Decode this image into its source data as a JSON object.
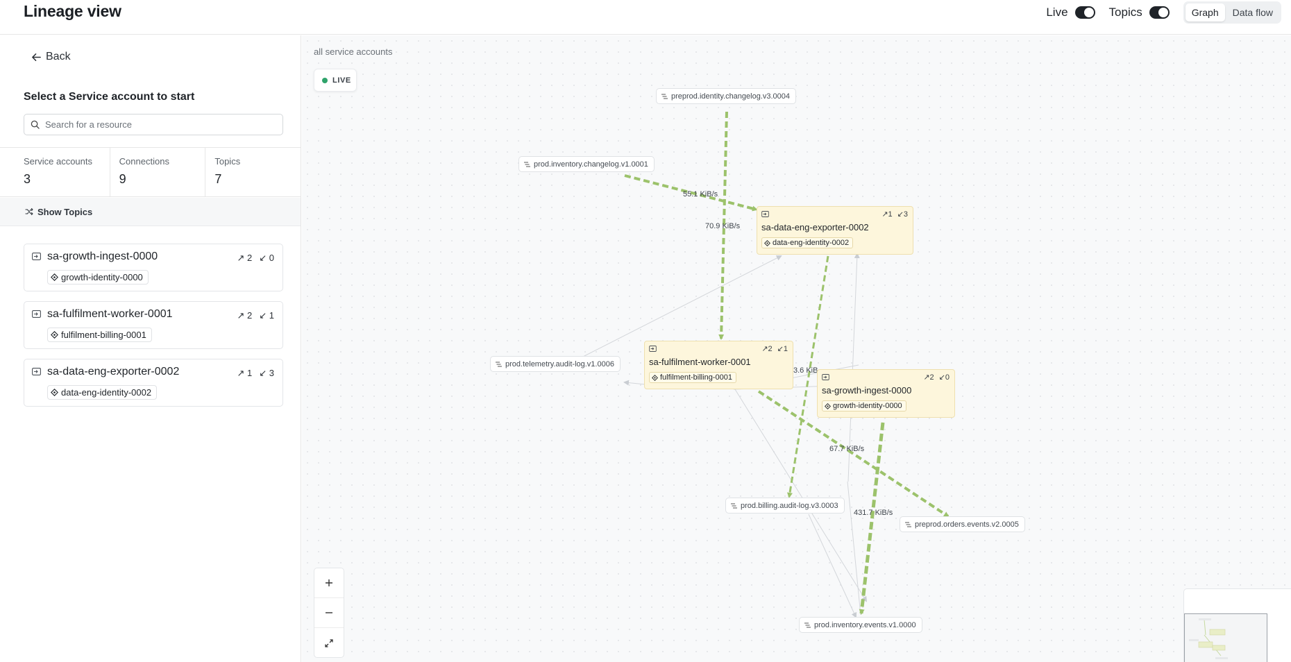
{
  "header": {
    "title": "Lineage view",
    "live_label": "Live",
    "topics_label": "Topics",
    "view_tabs": [
      "Graph",
      "Data flow"
    ],
    "active_tab": "Graph"
  },
  "sidebar": {
    "back_label": "Back",
    "select_title": "Select a Service account to start",
    "search_placeholder": "Search for a resource",
    "stats": [
      {
        "label": "Service accounts",
        "value": "3"
      },
      {
        "label": "Connections",
        "value": "9"
      },
      {
        "label": "Topics",
        "value": "7"
      }
    ],
    "show_topics_label": "Show Topics",
    "accounts": [
      {
        "name": "sa-growth-ingest-0000",
        "identity": "growth-identity-0000",
        "out": "2",
        "in": "0"
      },
      {
        "name": "sa-fulfilment-worker-0001",
        "identity": "fulfilment-billing-0001",
        "out": "2",
        "in": "1"
      },
      {
        "name": "sa-data-eng-exporter-0002",
        "identity": "data-eng-identity-0002",
        "out": "1",
        "in": "3"
      }
    ]
  },
  "canvas": {
    "breadcrumb": "all service accounts",
    "live_badge": "LIVE",
    "topics": [
      "preprod.identity.changelog.v3.0004",
      "prod.inventory.changelog.v1.0001",
      "prod.telemetry.audit-log.v1.0006",
      "prod.billing.audit-log.v3.0003",
      "preprod.orders.events.v2.0005",
      "prod.inventory.events.v1.0000"
    ],
    "service_nodes": [
      {
        "name": "sa-data-eng-exporter-0002",
        "identity": "data-eng-identity-0002",
        "out": "1",
        "in": "3"
      },
      {
        "name": "sa-fulfilment-worker-0001",
        "identity": "fulfilment-billing-0001",
        "out": "2",
        "in": "1"
      },
      {
        "name": "sa-growth-ingest-0000",
        "identity": "growth-identity-0000",
        "out": "2",
        "in": "0"
      }
    ],
    "edge_labels": [
      "55.1 KiB/s",
      "70.9 KiB/s",
      "3.6 KiB",
      "67.7 KiB/s",
      "431.7 KiB/s"
    ],
    "edge_color": "#9cc26b",
    "node_color": "#fdf6dc"
  }
}
